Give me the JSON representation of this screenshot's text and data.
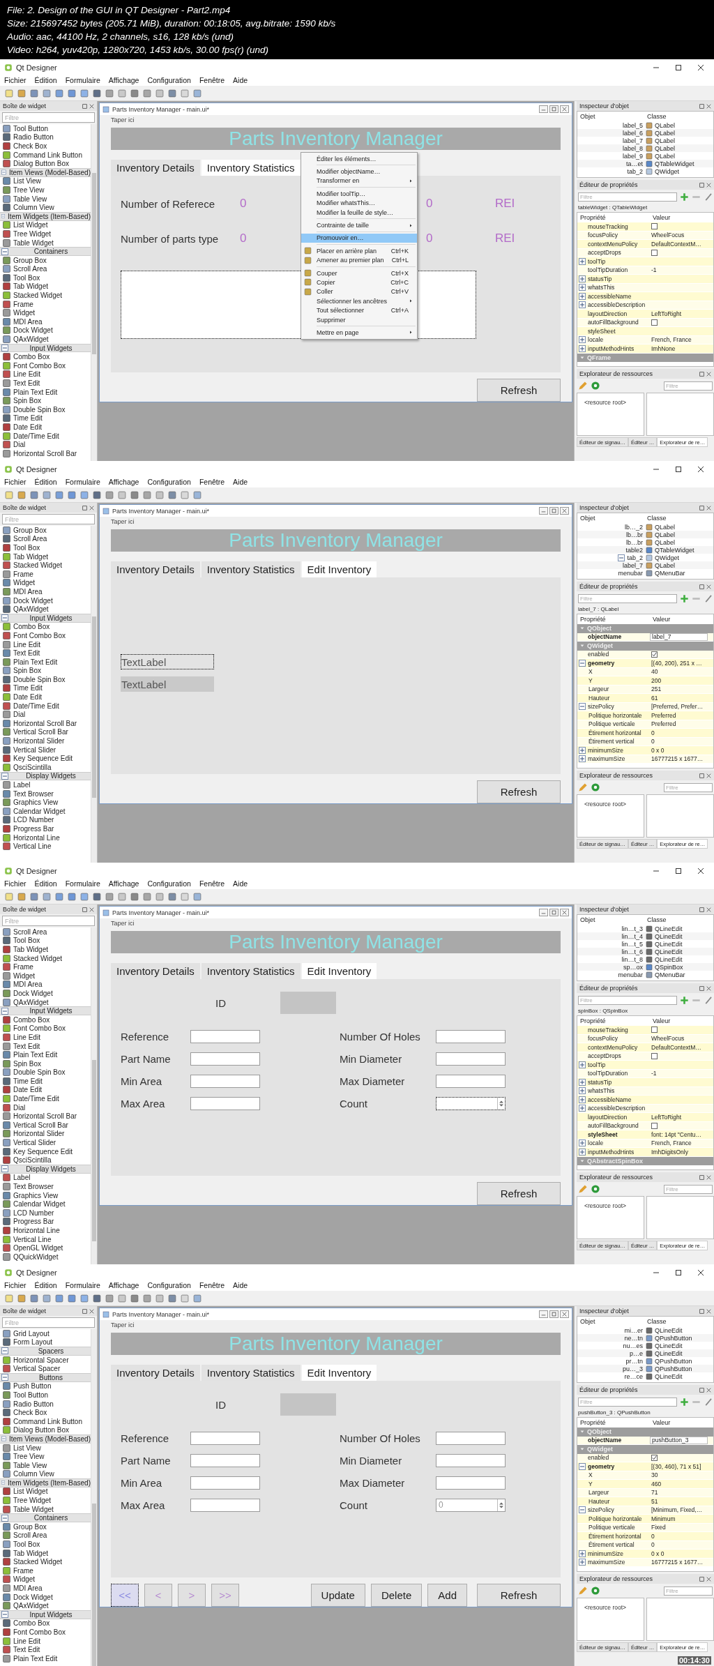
{
  "header": [
    "File: 2. Design of the GUI in QT Designer - Part2.mp4",
    "Size: 215697452 bytes (205.71 MiB), duration: 00:18:05, avg.bitrate: 1590 kb/s",
    "Audio: aac, 44100 Hz, 2 channels, s16, 128 kb/s (und)",
    "Video: h264, yuv420p, 1280x720, 1453 kb/s, 30.00 fps(r) (und)"
  ],
  "frames": [
    {
      "app_title": "Qt Designer",
      "menus": [
        "Fichier",
        "Édition",
        "Formulaire",
        "Affichage",
        "Configuration",
        "Fenêtre",
        "Aide"
      ],
      "widget_box": {
        "title": "Boîte de widget",
        "filter_placeholder": "Filtre",
        "items": [
          {
            "label": "Tool Button",
            "kind": "item"
          },
          {
            "label": "Radio Button",
            "kind": "item"
          },
          {
            "label": "Check Box",
            "kind": "item"
          },
          {
            "label": "Command Link Button",
            "kind": "item"
          },
          {
            "label": "Dialog Button Box",
            "kind": "item"
          },
          {
            "label": "Item Views (Model-Based)",
            "kind": "category"
          },
          {
            "label": "List View",
            "kind": "item"
          },
          {
            "label": "Tree View",
            "kind": "item"
          },
          {
            "label": "Table View",
            "kind": "item"
          },
          {
            "label": "Column View",
            "kind": "item"
          },
          {
            "label": "Item Widgets (Item-Based)",
            "kind": "category"
          },
          {
            "label": "List Widget",
            "kind": "item"
          },
          {
            "label": "Tree Widget",
            "kind": "item"
          },
          {
            "label": "Table Widget",
            "kind": "item"
          },
          {
            "label": "Containers",
            "kind": "category"
          },
          {
            "label": "Group Box",
            "kind": "item"
          },
          {
            "label": "Scroll Area",
            "kind": "item"
          },
          {
            "label": "Tool Box",
            "kind": "item"
          },
          {
            "label": "Tab Widget",
            "kind": "item"
          },
          {
            "label": "Stacked Widget",
            "kind": "item"
          },
          {
            "label": "Frame",
            "kind": "item"
          },
          {
            "label": "Widget",
            "kind": "item"
          },
          {
            "label": "MDI Area",
            "kind": "item"
          },
          {
            "label": "Dock Widget",
            "kind": "item"
          },
          {
            "label": "QAxWidget",
            "kind": "item"
          },
          {
            "label": "Input Widgets",
            "kind": "category"
          },
          {
            "label": "Combo Box",
            "kind": "item"
          },
          {
            "label": "Font Combo Box",
            "kind": "item"
          },
          {
            "label": "Line Edit",
            "kind": "item"
          },
          {
            "label": "Text Edit",
            "kind": "item"
          },
          {
            "label": "Plain Text Edit",
            "kind": "item"
          },
          {
            "label": "Spin Box",
            "kind": "item"
          },
          {
            "label": "Double Spin Box",
            "kind": "item"
          },
          {
            "label": "Time Edit",
            "kind": "item"
          },
          {
            "label": "Date Edit",
            "kind": "item"
          },
          {
            "label": "Date/Time Edit",
            "kind": "item"
          },
          {
            "label": "Dial",
            "kind": "item"
          },
          {
            "label": "Horizontal Scroll Bar",
            "kind": "item"
          }
        ]
      },
      "form": {
        "title": "Parts Inventory Manager - main.ui*",
        "menu_hint": "Taper ici",
        "banner": "Parts Inventory Manager",
        "tabs": [
          {
            "label": "Inventory Details",
            "selected": false
          },
          {
            "label": "Inventory Statistics",
            "selected": true
          }
        ],
        "content": {
          "kind": "stats",
          "rows": [
            {
              "label": "Number of Referece",
              "cells": [
                "0",
                "0",
                "REI"
              ]
            },
            {
              "label": "Number of parts type",
              "cells": [
                "0",
                "0",
                "REI"
              ]
            }
          ],
          "table": {
            "selected": true
          }
        },
        "refresh": "Refresh",
        "context_menu": {
          "items": [
            {
              "kind": "item",
              "label": "Éditer les éléments…",
              "selected": false
            },
            {
              "kind": "separator"
            },
            {
              "kind": "item",
              "label": "Modifier objectName…",
              "selected": false
            },
            {
              "kind": "item",
              "label": "Transformer en",
              "submenu": true,
              "selected": false
            },
            {
              "kind": "separator"
            },
            {
              "kind": "item",
              "label": "Modifier toolTip…",
              "selected": false
            },
            {
              "kind": "item",
              "label": "Modifier whatsThis…",
              "selected": false
            },
            {
              "kind": "item",
              "label": "Modifier la feuille de style…",
              "selected": false
            },
            {
              "kind": "separator"
            },
            {
              "kind": "item",
              "label": "Contrainte de taille",
              "submenu": true,
              "selected": false
            },
            {
              "kind": "separator"
            },
            {
              "kind": "item",
              "label": "Promouvoir en…",
              "selected": true
            },
            {
              "kind": "separator"
            },
            {
              "kind": "icon-item",
              "label": "Placer en arrière plan",
              "shortcut": "Ctrl+K",
              "selected": false
            },
            {
              "kind": "icon-item",
              "label": "Amener au premier plan",
              "shortcut": "Ctrl+L",
              "selected": false
            },
            {
              "kind": "separator"
            },
            {
              "kind": "icon-item",
              "label": "Couper",
              "shortcut": "Ctrl+X",
              "selected": false
            },
            {
              "kind": "icon-item",
              "label": "Copier",
              "shortcut": "Ctrl+C",
              "selected": false
            },
            {
              "kind": "icon-item",
              "label": "Coller",
              "shortcut": "Ctrl+V",
              "selected": false
            },
            {
              "kind": "item",
              "label": "Sélectionner les ancêtres",
              "submenu": true,
              "selected": false
            },
            {
              "kind": "item",
              "label": "Tout sélectionner",
              "shortcut": "Ctrl+A",
              "selected": false
            },
            {
              "kind": "item",
              "label": "Supprimer",
              "selected": false
            },
            {
              "kind": "separator"
            },
            {
              "kind": "item",
              "label": "Mettre en page",
              "submenu": true,
              "selected": false
            }
          ]
        }
      },
      "inspector": {
        "title": "Inspecteur d'objet",
        "columns": [
          "Objet",
          "Classe"
        ],
        "rows": [
          {
            "object": "label_5",
            "class": "QLabel",
            "kind": "label"
          },
          {
            "object": "label_6",
            "class": "QLabel",
            "kind": "label"
          },
          {
            "object": "label_7",
            "class": "QLabel",
            "kind": "label"
          },
          {
            "object": "label_8",
            "class": "QLabel",
            "kind": "label"
          },
          {
            "object": "label_9",
            "class": "QLabel",
            "kind": "label"
          },
          {
            "object": "ta…et",
            "class": "QTableWidget",
            "kind": "table"
          },
          {
            "object": "tab_2",
            "class": "QWidget",
            "kind": "widget"
          }
        ]
      },
      "properties": {
        "title": "Éditeur de propriétés",
        "filter_placeholder": "Filtre",
        "object": "tableWidget : QTableWidget",
        "columns": [
          "Propriété",
          "Valeur"
        ],
        "rows": [
          {
            "kind": "checkbox",
            "name": "mouseTracking",
            "checked": false
          },
          {
            "kind": "text",
            "name": "focusPolicy",
            "value": "WheelFocus"
          },
          {
            "kind": "text",
            "name": "contextMenuPolicy",
            "value": "DefaultContextM…"
          },
          {
            "kind": "checkbox",
            "name": "acceptDrops",
            "checked": false
          },
          {
            "kind": "text",
            "name": "toolTip",
            "expanded": false
          },
          {
            "kind": "text",
            "name": "toolTipDuration",
            "value": "-1"
          },
          {
            "kind": "text",
            "name": "statusTip",
            "expanded": false
          },
          {
            "kind": "text",
            "name": "whatsThis",
            "expanded": false
          },
          {
            "kind": "text",
            "name": "accessibleName",
            "expanded": false
          },
          {
            "kind": "text",
            "name": "accessibleDescription",
            "expanded": false
          },
          {
            "kind": "text",
            "name": "layoutDirection",
            "value": "LeftToRight"
          },
          {
            "kind": "checkbox",
            "name": "autoFillBackground",
            "checked": false
          },
          {
            "kind": "text",
            "name": "styleSheet"
          },
          {
            "kind": "text",
            "name": "locale",
            "value": "French, France",
            "expanded": false
          },
          {
            "kind": "text",
            "name": "inputMethodHints",
            "value": "ImhNone",
            "expanded": false
          },
          {
            "kind": "group",
            "name": "QFrame"
          }
        ]
      },
      "resources": {
        "title": "Explorateur de ressources",
        "filter_placeholder": "Filtre",
        "root": "<resource root>"
      },
      "bottom_tabs": [
        {
          "label": "Éditeur de signau…",
          "selected": false
        },
        {
          "label": "Éditeur …",
          "selected": false
        },
        {
          "label": "Explorateur de re…",
          "selected": true
        }
      ]
    },
    {
      "app_title": "Qt Designer",
      "menus": [
        "Fichier",
        "Édition",
        "Formulaire",
        "Affichage",
        "Configuration",
        "Fenêtre",
        "Aide"
      ],
      "widget_box": {
        "title": "Boîte de widget",
        "filter_placeholder": "Filtre",
        "items": [
          {
            "label": "Group Box",
            "kind": "item"
          },
          {
            "label": "Scroll Area",
            "kind": "item"
          },
          {
            "label": "Tool Box",
            "kind": "item"
          },
          {
            "label": "Tab Widget",
            "kind": "item"
          },
          {
            "label": "Stacked Widget",
            "kind": "item"
          },
          {
            "label": "Frame",
            "kind": "item"
          },
          {
            "label": "Widget",
            "kind": "item"
          },
          {
            "label": "MDI Area",
            "kind": "item"
          },
          {
            "label": "Dock Widget",
            "kind": "item"
          },
          {
            "label": "QAxWidget",
            "kind": "item"
          },
          {
            "label": "Input Widgets",
            "kind": "category"
          },
          {
            "label": "Combo Box",
            "kind": "item"
          },
          {
            "label": "Font Combo Box",
            "kind": "item"
          },
          {
            "label": "Line Edit",
            "kind": "item"
          },
          {
            "label": "Text Edit",
            "kind": "item"
          },
          {
            "label": "Plain Text Edit",
            "kind": "item"
          },
          {
            "label": "Spin Box",
            "kind": "item"
          },
          {
            "label": "Double Spin Box",
            "kind": "item"
          },
          {
            "label": "Time Edit",
            "kind": "item"
          },
          {
            "label": "Date Edit",
            "kind": "item"
          },
          {
            "label": "Date/Time Edit",
            "kind": "item"
          },
          {
            "label": "Dial",
            "kind": "item"
          },
          {
            "label": "Horizontal Scroll Bar",
            "kind": "item"
          },
          {
            "label": "Vertical Scroll Bar",
            "kind": "item"
          },
          {
            "label": "Horizontal Slider",
            "kind": "item"
          },
          {
            "label": "Vertical Slider",
            "kind": "item"
          },
          {
            "label": "Key Sequence Edit",
            "kind": "item"
          },
          {
            "label": "QsciScintilla",
            "kind": "item"
          },
          {
            "label": "Display Widgets",
            "kind": "category"
          },
          {
            "label": "Label",
            "kind": "item"
          },
          {
            "label": "Text Browser",
            "kind": "item"
          },
          {
            "label": "Graphics View",
            "kind": "item"
          },
          {
            "label": "Calendar Widget",
            "kind": "item"
          },
          {
            "label": "LCD Number",
            "kind": "item"
          },
          {
            "label": "Progress Bar",
            "kind": "item"
          },
          {
            "label": "Horizontal Line",
            "kind": "item"
          },
          {
            "label": "Vertical Line",
            "kind": "item"
          }
        ]
      },
      "form": {
        "title": "Parts Inventory Manager - main.ui*",
        "menu_hint": "Taper ici",
        "banner": "Parts Inventory Manager",
        "tabs": [
          {
            "label": "Inventory Details",
            "selected": false
          },
          {
            "label": "Inventory Statistics",
            "selected": false
          },
          {
            "label": "Edit Inventory",
            "selected": true
          }
        ],
        "content": {
          "kind": "labels",
          "labels": [
            {
              "text": "TextLabel",
              "selected": true,
              "hover": false
            },
            {
              "text": "TextLabel",
              "selected": false,
              "hover": true
            }
          ]
        },
        "refresh": "Refresh"
      },
      "inspector": {
        "title": "Inspecteur d'objet",
        "columns": [
          "Objet",
          "Classe"
        ],
        "rows": [
          {
            "object": "lb…_2",
            "class": "QLabel",
            "kind": "label"
          },
          {
            "object": "lb…br",
            "class": "QLabel",
            "kind": "label"
          },
          {
            "object": "lb…br",
            "class": "QLabel",
            "kind": "label"
          },
          {
            "object": "table2",
            "class": "QTableWidget",
            "kind": "table"
          },
          {
            "object": "tab_2",
            "class": "QWidget",
            "kind": "widget",
            "expanded": true
          },
          {
            "object": "label_7",
            "class": "QLabel",
            "kind": "label"
          },
          {
            "object": "menubar",
            "class": "QMenuBar",
            "kind": "menubar"
          }
        ]
      },
      "properties": {
        "title": "Éditeur de propriétés",
        "filter_placeholder": "Filtre",
        "object": "label_7 : QLabel",
        "columns": [
          "Propriété",
          "Valeur"
        ],
        "rows": [
          {
            "kind": "group",
            "name": "QObject"
          },
          {
            "kind": "field",
            "name": "objectName",
            "value": "label_7",
            "modified": true
          },
          {
            "kind": "group",
            "name": "QWidget"
          },
          {
            "kind": "checkbox",
            "name": "enabled",
            "checked": true
          },
          {
            "kind": "text",
            "name": "geometry",
            "value": "[(40, 200), 251 x …",
            "modified": true,
            "expanded": true,
            "children": [
              {
                "kind": "text",
                "name": "X",
                "value": "40"
              },
              {
                "kind": "text",
                "name": "Y",
                "value": "200"
              },
              {
                "kind": "text",
                "name": "Largeur",
                "value": "251"
              },
              {
                "kind": "text",
                "name": "Hauteur",
                "value": "61"
              }
            ]
          },
          {
            "kind": "text",
            "name": "sizePolicy",
            "value": "[Preferred, Prefer…",
            "expanded": true,
            "children": [
              {
                "kind": "text",
                "name": "Politique horizontale",
                "value": "Preferred"
              },
              {
                "kind": "text",
                "name": "Politique verticale",
                "value": "Preferred"
              },
              {
                "kind": "text",
                "name": "Étirement horizontal",
                "value": "0"
              },
              {
                "kind": "text",
                "name": "Étirement vertical",
                "value": "0"
              }
            ]
          },
          {
            "kind": "text",
            "name": "minimumSize",
            "value": "0 x 0",
            "expanded": false
          },
          {
            "kind": "text",
            "name": "maximumSize",
            "value": "16777215 x 1677…",
            "expanded": false
          }
        ]
      },
      "resources": {
        "title": "Explorateur de ressources",
        "filter_placeholder": "Filtre",
        "root": "<resource root>"
      },
      "bottom_tabs": [
        {
          "label": "Éditeur de signau…",
          "selected": false
        },
        {
          "label": "Éditeur …",
          "selected": false
        },
        {
          "label": "Explorateur de re…",
          "selected": true
        }
      ]
    },
    {
      "app_title": "Qt Designer",
      "menus": [
        "Fichier",
        "Édition",
        "Formulaire",
        "Affichage",
        "Configuration",
        "Fenêtre",
        "Aide"
      ],
      "widget_box": {
        "title": "Boîte de widget",
        "filter_placeholder": "Filtre",
        "items": [
          {
            "label": "Scroll Area",
            "kind": "item"
          },
          {
            "label": "Tool Box",
            "kind": "item"
          },
          {
            "label": "Tab Widget",
            "kind": "item"
          },
          {
            "label": "Stacked Widget",
            "kind": "item"
          },
          {
            "label": "Frame",
            "kind": "item"
          },
          {
            "label": "Widget",
            "kind": "item"
          },
          {
            "label": "MDI Area",
            "kind": "item"
          },
          {
            "label": "Dock Widget",
            "kind": "item"
          },
          {
            "label": "QAxWidget",
            "kind": "item"
          },
          {
            "label": "Input Widgets",
            "kind": "category"
          },
          {
            "label": "Combo Box",
            "kind": "item"
          },
          {
            "label": "Font Combo Box",
            "kind": "item"
          },
          {
            "label": "Line Edit",
            "kind": "item"
          },
          {
            "label": "Text Edit",
            "kind": "item"
          },
          {
            "label": "Plain Text Edit",
            "kind": "item"
          },
          {
            "label": "Spin Box",
            "kind": "item"
          },
          {
            "label": "Double Spin Box",
            "kind": "item"
          },
          {
            "label": "Time Edit",
            "kind": "item"
          },
          {
            "label": "Date Edit",
            "kind": "item"
          },
          {
            "label": "Date/Time Edit",
            "kind": "item"
          },
          {
            "label": "Dial",
            "kind": "item"
          },
          {
            "label": "Horizontal Scroll Bar",
            "kind": "item"
          },
          {
            "label": "Vertical Scroll Bar",
            "kind": "item"
          },
          {
            "label": "Horizontal Slider",
            "kind": "item"
          },
          {
            "label": "Vertical Slider",
            "kind": "item"
          },
          {
            "label": "Key Sequence Edit",
            "kind": "item"
          },
          {
            "label": "QsciScintilla",
            "kind": "item"
          },
          {
            "label": "Display Widgets",
            "kind": "category"
          },
          {
            "label": "Label",
            "kind": "item"
          },
          {
            "label": "Text Browser",
            "kind": "item"
          },
          {
            "label": "Graphics View",
            "kind": "item"
          },
          {
            "label": "Calendar Widget",
            "kind": "item"
          },
          {
            "label": "LCD Number",
            "kind": "item"
          },
          {
            "label": "Progress Bar",
            "kind": "item"
          },
          {
            "label": "Horizontal Line",
            "kind": "item"
          },
          {
            "label": "Vertical Line",
            "kind": "item"
          },
          {
            "label": "OpenGL Widget",
            "kind": "item"
          },
          {
            "label": "QQuickWidget",
            "kind": "item"
          }
        ]
      },
      "form": {
        "title": "Parts Inventory Manager - main.ui*",
        "menu_hint": "Taper ici",
        "banner": "Parts Inventory Manager",
        "tabs": [
          {
            "label": "Inventory Details",
            "selected": false
          },
          {
            "label": "Inventory Statistics",
            "selected": false
          },
          {
            "label": "Edit Inventory",
            "selected": true
          }
        ],
        "content": {
          "kind": "edit",
          "id_label": "ID",
          "left": [
            {
              "label": "Reference"
            },
            {
              "label": "Part Name"
            },
            {
              "label": "Min Area"
            },
            {
              "label": "Max Area"
            }
          ],
          "right": [
            {
              "label": "Number Of Holes",
              "kind": "input"
            },
            {
              "label": "Min Diameter",
              "kind": "input"
            },
            {
              "label": "Max Diameter",
              "kind": "input"
            },
            {
              "label": "Count",
              "kind": "spin",
              "selected": true
            }
          ]
        },
        "refresh": "Refresh"
      },
      "inspector": {
        "title": "Inspecteur d'objet",
        "columns": [
          "Objet",
          "Classe"
        ],
        "rows": [
          {
            "object": "lin…t_3",
            "class": "QLineEdit",
            "kind": "lineedit"
          },
          {
            "object": "lin…t_4",
            "class": "QLineEdit",
            "kind": "lineedit"
          },
          {
            "object": "lin…t_5",
            "class": "QLineEdit",
            "kind": "lineedit"
          },
          {
            "object": "lin…t_6",
            "class": "QLineEdit",
            "kind": "lineedit"
          },
          {
            "object": "lin…t_8",
            "class": "QLineEdit",
            "kind": "lineedit"
          },
          {
            "object": "sp…ox",
            "class": "QSpinBox",
            "kind": "spinbox"
          },
          {
            "object": "menubar",
            "class": "QMenuBar",
            "kind": "menubar"
          }
        ]
      },
      "properties": {
        "title": "Éditeur de propriétés",
        "filter_placeholder": "Filtre",
        "object": "spinBox : QSpinBox",
        "columns": [
          "Propriété",
          "Valeur"
        ],
        "rows": [
          {
            "kind": "checkbox",
            "name": "mouseTracking",
            "checked": false
          },
          {
            "kind": "text",
            "name": "focusPolicy",
            "value": "WheelFocus"
          },
          {
            "kind": "text",
            "name": "contextMenuPolicy",
            "value": "DefaultContextM…"
          },
          {
            "kind": "checkbox",
            "name": "acceptDrops",
            "checked": false
          },
          {
            "kind": "text",
            "name": "toolTip",
            "expanded": false
          },
          {
            "kind": "text",
            "name": "toolTipDuration",
            "value": "-1"
          },
          {
            "kind": "text",
            "name": "statusTip",
            "expanded": false
          },
          {
            "kind": "text",
            "name": "whatsThis",
            "expanded": false
          },
          {
            "kind": "text",
            "name": "accessibleName",
            "expanded": false
          },
          {
            "kind": "text",
            "name": "accessibleDescription",
            "expanded": false
          },
          {
            "kind": "text",
            "name": "layoutDirection",
            "value": "LeftToRight"
          },
          {
            "kind": "checkbox",
            "name": "autoFillBackground",
            "checked": false
          },
          {
            "kind": "text",
            "name": "styleSheet",
            "value": "font: 14pt \"Centu…",
            "modified": true
          },
          {
            "kind": "text",
            "name": "locale",
            "value": "French, France",
            "expanded": false
          },
          {
            "kind": "text",
            "name": "inputMethodHints",
            "value": "ImhDigitsOnly",
            "expanded": false
          },
          {
            "kind": "group",
            "name": "QAbstractSpinBox"
          }
        ]
      },
      "resources": {
        "title": "Explorateur de ressources",
        "filter_placeholder": "Filtre",
        "root": "<resource root>"
      },
      "bottom_tabs": [
        {
          "label": "Éditeur de signau…",
          "selected": false
        },
        {
          "label": "Éditeur …",
          "selected": false
        },
        {
          "label": "Explorateur de re…",
          "selected": true
        }
      ]
    },
    {
      "app_title": "Qt Designer",
      "menus": [
        "Fichier",
        "Édition",
        "Formulaire",
        "Affichage",
        "Configuration",
        "Fenêtre",
        "Aide"
      ],
      "widget_box": {
        "title": "Boîte de widget",
        "filter_placeholder": "Filtre",
        "items": [
          {
            "label": "Grid Layout",
            "kind": "item"
          },
          {
            "label": "Form Layout",
            "kind": "item"
          },
          {
            "label": "Spacers",
            "kind": "category"
          },
          {
            "label": "Horizontal Spacer",
            "kind": "item"
          },
          {
            "label": "Vertical Spacer",
            "kind": "item"
          },
          {
            "label": "Buttons",
            "kind": "category"
          },
          {
            "label": "Push Button",
            "kind": "item"
          },
          {
            "label": "Tool Button",
            "kind": "item"
          },
          {
            "label": "Radio Button",
            "kind": "item"
          },
          {
            "label": "Check Box",
            "kind": "item"
          },
          {
            "label": "Command Link Button",
            "kind": "item"
          },
          {
            "label": "Dialog Button Box",
            "kind": "item"
          },
          {
            "label": "Item Views (Model-Based)",
            "kind": "category"
          },
          {
            "label": "List View",
            "kind": "item"
          },
          {
            "label": "Tree View",
            "kind": "item"
          },
          {
            "label": "Table View",
            "kind": "item"
          },
          {
            "label": "Column View",
            "kind": "item"
          },
          {
            "label": "Item Widgets (Item-Based)",
            "kind": "category"
          },
          {
            "label": "List Widget",
            "kind": "item"
          },
          {
            "label": "Tree Widget",
            "kind": "item"
          },
          {
            "label": "Table Widget",
            "kind": "item"
          },
          {
            "label": "Containers",
            "kind": "category"
          },
          {
            "label": "Group Box",
            "kind": "item"
          },
          {
            "label": "Scroll Area",
            "kind": "item"
          },
          {
            "label": "Tool Box",
            "kind": "item"
          },
          {
            "label": "Tab Widget",
            "kind": "item"
          },
          {
            "label": "Stacked Widget",
            "kind": "item"
          },
          {
            "label": "Frame",
            "kind": "item"
          },
          {
            "label": "Widget",
            "kind": "item"
          },
          {
            "label": "MDI Area",
            "kind": "item"
          },
          {
            "label": "Dock Widget",
            "kind": "item"
          },
          {
            "label": "QAxWidget",
            "kind": "item"
          },
          {
            "label": "Input Widgets",
            "kind": "category"
          },
          {
            "label": "Combo Box",
            "kind": "item"
          },
          {
            "label": "Font Combo Box",
            "kind": "item"
          },
          {
            "label": "Line Edit",
            "kind": "item"
          },
          {
            "label": "Text Edit",
            "kind": "item"
          },
          {
            "label": "Plain Text Edit",
            "kind": "item"
          }
        ]
      },
      "form": {
        "title": "Parts Inventory Manager - main.ui*",
        "menu_hint": "Taper ici",
        "banner": "Parts Inventory Manager",
        "tabs": [
          {
            "label": "Inventory Details",
            "selected": false
          },
          {
            "label": "Inventory Statistics",
            "selected": false
          },
          {
            "label": "Edit Inventory",
            "selected": true
          }
        ],
        "content": {
          "kind": "edit",
          "id_label": "ID",
          "left": [
            {
              "label": "Reference"
            },
            {
              "label": "Part Name"
            },
            {
              "label": "Min Area"
            },
            {
              "label": "Max Area"
            }
          ],
          "right": [
            {
              "label": "Number Of Holes",
              "kind": "input"
            },
            {
              "label": "Min Diameter",
              "kind": "input"
            },
            {
              "label": "Max Diameter",
              "kind": "input"
            },
            {
              "label": "Count",
              "kind": "spin",
              "value": "0",
              "selected": false
            }
          ],
          "nav_buttons": [
            {
              "label": "<<",
              "selected": true
            },
            {
              "label": "<",
              "selected": false
            },
            {
              "label": ">",
              "selected": false
            },
            {
              "label": ">>",
              "selected": false
            }
          ],
          "action_buttons": [
            "Update",
            "Delete",
            "Add"
          ]
        },
        "refresh": "Refresh"
      },
      "inspector": {
        "title": "Inspecteur d'objet",
        "columns": [
          "Objet",
          "Classe"
        ],
        "rows": [
          {
            "object": "mi…er",
            "class": "QLineEdit",
            "kind": "lineedit"
          },
          {
            "object": "ne…tn",
            "class": "QPushButton",
            "kind": "button"
          },
          {
            "object": "nu…es",
            "class": "QLineEdit",
            "kind": "lineedit"
          },
          {
            "object": "p…e",
            "class": "QLineEdit",
            "kind": "lineedit"
          },
          {
            "object": "pr…tn",
            "class": "QPushButton",
            "kind": "button"
          },
          {
            "object": "pu…_3",
            "class": "QPushButton",
            "kind": "button"
          },
          {
            "object": "re…ce",
            "class": "QLineEdit",
            "kind": "lineedit"
          }
        ]
      },
      "properties": {
        "title": "Éditeur de propriétés",
        "filter_placeholder": "Filtre",
        "object": "pushButton_3 : QPushButton",
        "columns": [
          "Propriété",
          "Valeur"
        ],
        "rows": [
          {
            "kind": "group",
            "name": "QObject"
          },
          {
            "kind": "field",
            "name": "objectName",
            "value": "pushButton_3",
            "modified": true
          },
          {
            "kind": "group",
            "name": "QWidget"
          },
          {
            "kind": "checkbox",
            "name": "enabled",
            "checked": true
          },
          {
            "kind": "text",
            "name": "geometry",
            "value": "[(30, 460), 71 x 51]",
            "modified": true,
            "expanded": true,
            "children": [
              {
                "kind": "text",
                "name": "X",
                "value": "30"
              },
              {
                "kind": "text",
                "name": "Y",
                "value": "460"
              },
              {
                "kind": "text",
                "name": "Largeur",
                "value": "71"
              },
              {
                "kind": "text",
                "name": "Hauteur",
                "value": "51"
              }
            ]
          },
          {
            "kind": "text",
            "name": "sizePolicy",
            "value": "[Minimum, Fixed,…",
            "expanded": true,
            "children": [
              {
                "kind": "text",
                "name": "Politique horizontale",
                "value": "Minimum"
              },
              {
                "kind": "text",
                "name": "Politique verticale",
                "value": "Fixed"
              },
              {
                "kind": "text",
                "name": "Étirement horizontal",
                "value": "0"
              },
              {
                "kind": "text",
                "name": "Étirement vertical",
                "value": "0"
              }
            ]
          },
          {
            "kind": "text",
            "name": "minimumSize",
            "value": "0 x 0",
            "expanded": false
          },
          {
            "kind": "text",
            "name": "maximumSize",
            "value": "16777215 x 1677…",
            "expanded": false
          }
        ]
      },
      "resources": {
        "title": "Explorateur de ressources",
        "filter_placeholder": "Filtre",
        "root": "<resource root>"
      },
      "bottom_tabs": [
        {
          "label": "Éditeur de signau…",
          "selected": false
        },
        {
          "label": "Éditeur …",
          "selected": false
        },
        {
          "label": "Explorateur de re…",
          "selected": true
        }
      ],
      "timestamp": "00:14:30"
    }
  ]
}
